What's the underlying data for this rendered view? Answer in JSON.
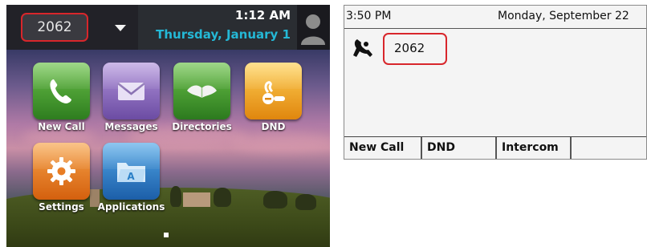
{
  "left_phone": {
    "status_bar": {
      "line_label": "2062",
      "time": "1:12 AM",
      "date": "Thursday, January 1"
    },
    "apps": [
      {
        "label": "New Call",
        "icon": "phone-handset-icon",
        "color": "#3f9a2e"
      },
      {
        "label": "Messages",
        "icon": "envelope-icon",
        "color": "#8f6bc1"
      },
      {
        "label": "Directories",
        "icon": "open-book-icon",
        "color": "#3e9e3a"
      },
      {
        "label": "DND",
        "icon": "dnd-icon",
        "color": "#f0a21a"
      },
      {
        "label": "Settings",
        "icon": "gear-icon",
        "color": "#e77a1e"
      },
      {
        "label": "Applications",
        "icon": "folder-icon",
        "color": "#2a7fc7"
      }
    ]
  },
  "right_phone": {
    "header": {
      "time": "3:50 PM",
      "date": "Monday, September 22"
    },
    "line_label": "2062",
    "softkeys": [
      "New Call",
      "DND",
      "Intercom",
      ""
    ]
  },
  "colors": {
    "highlight_border": "#d8262b",
    "date_accent": "#24b8d6",
    "status_bar_bg": "#222228"
  }
}
